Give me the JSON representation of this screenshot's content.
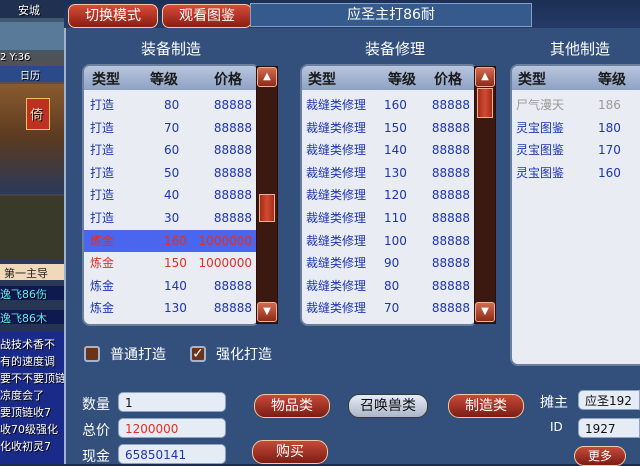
{
  "scene": {
    "city_label": "安城",
    "coords": "2 Y:36",
    "calendar_btn": "日历",
    "banner": "倚",
    "chat_label_1": "第一主导",
    "chat_label_2": "逸飞86伤",
    "chat_label_3": "逸飞86木",
    "chat_lines": [
      "战技术香不",
      "有的速度调",
      "要不不要顶链",
      "凉度会了",
      "要顶链收7",
      "收70级强化",
      "化收初灵7"
    ]
  },
  "window": {
    "switch_mode_button": "切换模式",
    "view_catalog_button": "观看图鉴",
    "title": "应圣主打86耐"
  },
  "sections": {
    "craft": "装备制造",
    "repair": "装备修理",
    "other": "其他制造"
  },
  "headers": {
    "type": "类型",
    "level": "等级",
    "price": "价格"
  },
  "craft_rows": [
    {
      "type": "打造",
      "level": "80",
      "price": "88888",
      "color": "#1d35b0"
    },
    {
      "type": "打造",
      "level": "70",
      "price": "88888",
      "color": "#1d35b0"
    },
    {
      "type": "打造",
      "level": "60",
      "price": "88888",
      "color": "#1d35b0"
    },
    {
      "type": "打造",
      "level": "50",
      "price": "88888",
      "color": "#1d35b0"
    },
    {
      "type": "打造",
      "level": "40",
      "price": "88888",
      "color": "#1d35b0"
    },
    {
      "type": "打造",
      "level": "30",
      "price": "88888",
      "color": "#1d35b0"
    },
    {
      "type": "炼金",
      "level": "160",
      "price": "1000000",
      "color": "#e03020",
      "selected": true
    },
    {
      "type": "炼金",
      "level": "150",
      "price": "1000000",
      "color": "#e03020"
    },
    {
      "type": "炼金",
      "level": "140",
      "price": "88888",
      "color": "#1d35b0"
    },
    {
      "type": "炼金",
      "level": "130",
      "price": "88888",
      "color": "#1d35b0"
    }
  ],
  "repair_rows": [
    {
      "type": "裁缝类修理",
      "level": "160",
      "price": "88888"
    },
    {
      "type": "裁缝类修理",
      "level": "150",
      "price": "88888"
    },
    {
      "type": "裁缝类修理",
      "level": "140",
      "price": "88888"
    },
    {
      "type": "裁缝类修理",
      "level": "130",
      "price": "88888"
    },
    {
      "type": "裁缝类修理",
      "level": "120",
      "price": "88888"
    },
    {
      "type": "裁缝类修理",
      "level": "110",
      "price": "88888"
    },
    {
      "type": "裁缝类修理",
      "level": "100",
      "price": "88888"
    },
    {
      "type": "裁缝类修理",
      "level": "90",
      "price": "88888"
    },
    {
      "type": "裁缝类修理",
      "level": "80",
      "price": "88888"
    },
    {
      "type": "裁缝类修理",
      "level": "70",
      "price": "88888"
    }
  ],
  "other_rows": [
    {
      "type": "尸气漫天",
      "level": "186",
      "color": "#9a9a9a"
    },
    {
      "type": "灵宝图鉴",
      "level": "180",
      "color": "#1d35b0"
    },
    {
      "type": "灵宝图鉴",
      "level": "170",
      "color": "#1d35b0"
    },
    {
      "type": "灵宝图鉴",
      "level": "160",
      "color": "#1d35b0"
    }
  ],
  "options": {
    "normal_craft": "普通打造",
    "normal_checked": false,
    "enhanced_craft": "强化打造",
    "enhanced_checked": true
  },
  "order": {
    "qty_label": "数量",
    "qty": "1",
    "total_label": "总价",
    "total": "1200000",
    "cash_label": "现金",
    "cash": "65850141"
  },
  "buttons": {
    "items": "物品类",
    "summon": "召唤兽类",
    "craft": "制造类",
    "buy": "购买",
    "more": "更多"
  },
  "stall": {
    "owner_label": "摊主",
    "owner": "应圣192",
    "id_label": "ID",
    "id": "1927"
  }
}
